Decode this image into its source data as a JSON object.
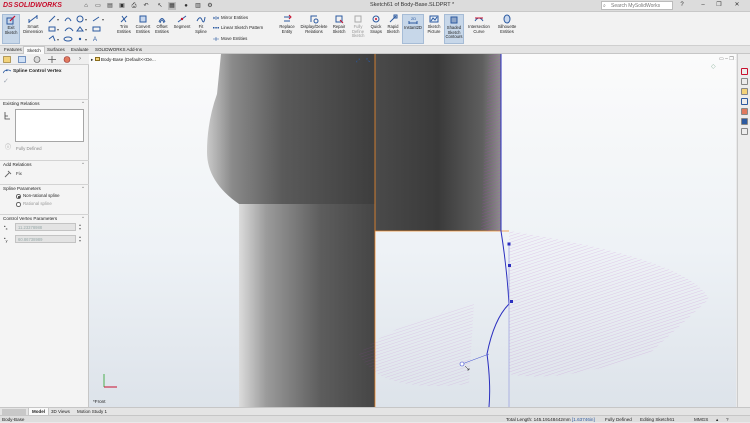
{
  "app": {
    "brand_prefix": "DS",
    "brand": "SOLIDWORKS",
    "document_title": "Sketch61 of Body-Base.SLDPRT *",
    "search_placeholder": "Search MySolidWorks"
  },
  "ribbon": {
    "buttons": [
      {
        "label": "Exit Sketch",
        "active": true
      },
      {
        "label": "Smart Dimension"
      },
      {
        "label": "Trim Entities"
      },
      {
        "label": "Convert Entities"
      },
      {
        "label": "Offset Entities"
      },
      {
        "label": "Segment"
      },
      {
        "label": "Fit Spline"
      },
      {
        "label": "Replace Entity"
      },
      {
        "label": "Display/Delete Relations"
      },
      {
        "label": "Repair Sketch"
      },
      {
        "label": "Fully Define Sketch"
      },
      {
        "label": "Quick Snaps"
      },
      {
        "label": "Rapid Sketch"
      },
      {
        "label": "Instant2D",
        "active": true
      },
      {
        "label": "Sketch Picture"
      },
      {
        "label": "Shaded Sketch Contours",
        "active": true
      },
      {
        "label": "Intersection Curve"
      },
      {
        "label": "Silhouette Entities"
      }
    ],
    "small": {
      "mirror": "Mirror Entities",
      "linear_pattern": "Linear Sketch Pattern",
      "move": "Move Entities"
    }
  },
  "tabs": [
    "Features",
    "Sketch",
    "Surfaces",
    "Evaluate",
    "SOLIDWORKS Add-Ins"
  ],
  "active_tab": "Sketch",
  "panel": {
    "title": "Spline Control Vertex",
    "existing_relations": "Existing Relations",
    "status": "Fully Defined",
    "add_relations": "Add Relations",
    "fix": "Fix",
    "spline_parameters": "Spline Parameters",
    "option_nonrational": "Non-rational spline",
    "option_rational": "Rational spline",
    "control_vertex": "Control Vertex Parameters",
    "x_value": "11.23378988",
    "y_value": "60.86738989"
  },
  "viewport": {
    "tree_label": "Body-Base  (Default<<De...",
    "view_label": "*Front"
  },
  "bottom_tabs": [
    "Model",
    "3D Views",
    "Motion Study 1"
  ],
  "active_bottom_tab": "Model",
  "status": {
    "left": "Body-Base",
    "total_length": "Total Length: 145.19148442mm",
    "highlight": "[1.63746in]",
    "defined": "Fully Defined",
    "editing": "Editing Sketch61",
    "units": "MMGS"
  },
  "colors": {
    "accent_red": "#c8102e",
    "active_button": "#c7d7e9",
    "spline": "#2b2fbf",
    "curvature_comb": "#b23cc2",
    "sketch_orange": "#f08a2c"
  }
}
